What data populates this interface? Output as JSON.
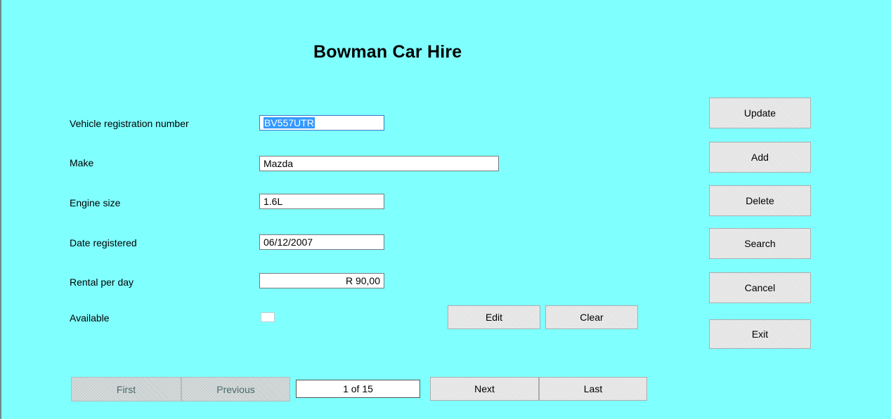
{
  "app": {
    "title": "Bowman Car Hire"
  },
  "form": {
    "registration_label": "Vehicle registration number",
    "registration_value": "BV557UTR",
    "make_label": "Make",
    "make_value": "Mazda",
    "engine_label": "Engine size",
    "engine_value": "1.6L",
    "date_label": "Date registered",
    "date_value": "06/12/2007",
    "rental_label": "Rental per day",
    "rental_value": "R  90,00",
    "available_label": "Available",
    "available_checked": false
  },
  "actions": {
    "update": "Update",
    "add": "Add",
    "delete": "Delete",
    "search": "Search",
    "cancel": "Cancel",
    "exit": "Exit",
    "edit": "Edit",
    "clear": "Clear"
  },
  "navigation": {
    "first": "First",
    "previous": "Previous",
    "position": "1 of 15",
    "next": "Next",
    "last": "Last"
  },
  "colors": {
    "background": "#80ffff",
    "button": "#e3e3e3",
    "selection": "#3399ff"
  }
}
